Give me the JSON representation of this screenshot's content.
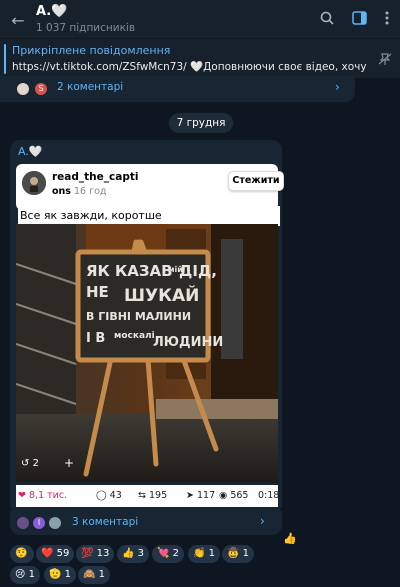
{
  "header": {
    "title": "A.🤍",
    "subtitle": "1 037 підписників"
  },
  "pinned": {
    "title": "Прикріплене повідомлення",
    "text": "https://vt.tiktok.com/ZSfwMcn73/ 🤍Доповнюючи своє відео, хочу ..."
  },
  "top_comments": {
    "label": "2 коментарі"
  },
  "date_separator": "7 грудня",
  "post": {
    "author": "A.🤍",
    "card": {
      "name": "read_the_capti",
      "sub": "ons",
      "time": "16 год",
      "follow": "Стежити"
    },
    "caption": "Все як завжди, коротше",
    "sign_text": [
      "ЯК КАЗАВ",
      "мій",
      "ДІД,",
      "НЕ",
      "ШУКАЙ",
      "В ГІВНІ МАЛИНИ",
      "І В",
      "москалі",
      "ЛЮДИНИ"
    ],
    "repost_count": "2",
    "likes": "8,1 тис.",
    "comments": "43",
    "reposts": "195",
    "shares": "117",
    "views": "565",
    "time": "0:18"
  },
  "bottom_comments": {
    "label": "3 коментарі"
  },
  "reactions": [
    {
      "emoji": "🤨",
      "count": ""
    },
    {
      "emoji": "❤️",
      "count": "59"
    },
    {
      "emoji": "💯",
      "count": "13"
    },
    {
      "emoji": "👍",
      "count": "3"
    },
    {
      "emoji": "💘",
      "count": "2"
    },
    {
      "emoji": "👏",
      "count": "1"
    },
    {
      "emoji": "🤠",
      "count": "1"
    },
    {
      "emoji": "😢",
      "count": "1"
    },
    {
      "emoji": "🫡",
      "count": "1"
    },
    {
      "emoji": "🙈",
      "count": "1"
    }
  ],
  "colors": {
    "accent": "#5eb5f7",
    "bg": "#0e1621",
    "bubble": "#182533"
  }
}
